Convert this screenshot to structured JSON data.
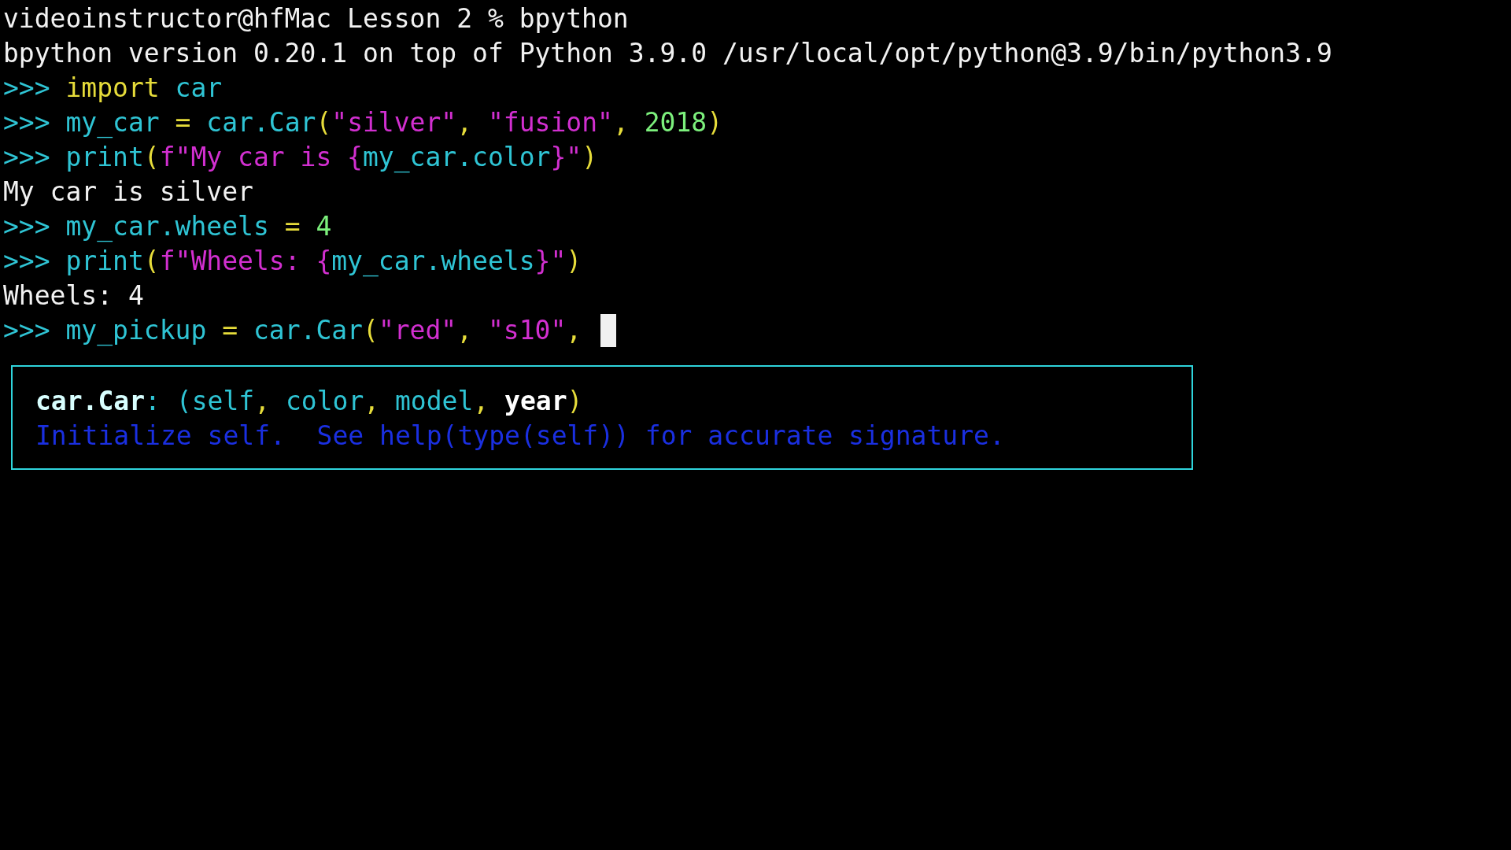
{
  "terminal": {
    "lines": [
      {
        "tokens": [
          {
            "text": "videoinstructor@hfMac Lesson 2 % bpython",
            "kind": "plain"
          }
        ]
      },
      {
        "tokens": [
          {
            "text": "bpython version 0.20.1 on top of Python 3.9.0 /usr/local/opt/python@3.9/bin/python3.9",
            "kind": "plain"
          }
        ]
      },
      {
        "tokens": [
          {
            "text": ">>> ",
            "kind": "prompt"
          },
          {
            "text": "import",
            "kind": "keyword"
          },
          {
            "text": " car",
            "kind": "name"
          }
        ]
      },
      {
        "tokens": [
          {
            "text": ">>> ",
            "kind": "prompt"
          },
          {
            "text": "my_car ",
            "kind": "name"
          },
          {
            "text": "=",
            "kind": "operator"
          },
          {
            "text": " car.Car",
            "kind": "name"
          },
          {
            "text": "(",
            "kind": "operator"
          },
          {
            "text": "\"silver\"",
            "kind": "string"
          },
          {
            "text": ", ",
            "kind": "operator"
          },
          {
            "text": "\"fusion\"",
            "kind": "string"
          },
          {
            "text": ", ",
            "kind": "operator"
          },
          {
            "text": "2018",
            "kind": "number"
          },
          {
            "text": ")",
            "kind": "operator"
          }
        ]
      },
      {
        "tokens": [
          {
            "text": ">>> ",
            "kind": "prompt"
          },
          {
            "text": "print",
            "kind": "name"
          },
          {
            "text": "(",
            "kind": "operator"
          },
          {
            "text": "f\"My car is {",
            "kind": "string"
          },
          {
            "text": "my_car.color",
            "kind": "name"
          },
          {
            "text": "}\"",
            "kind": "string"
          },
          {
            "text": ")",
            "kind": "operator"
          }
        ]
      },
      {
        "tokens": [
          {
            "text": "My car is silver",
            "kind": "plain"
          }
        ]
      },
      {
        "tokens": [
          {
            "text": ">>> ",
            "kind": "prompt"
          },
          {
            "text": "my_car.wheels ",
            "kind": "name"
          },
          {
            "text": "= ",
            "kind": "operator"
          },
          {
            "text": "4",
            "kind": "number"
          }
        ]
      },
      {
        "tokens": [
          {
            "text": ">>> ",
            "kind": "prompt"
          },
          {
            "text": "print",
            "kind": "name"
          },
          {
            "text": "(",
            "kind": "operator"
          },
          {
            "text": "f\"Wheels: {",
            "kind": "string"
          },
          {
            "text": "my_car.wheels",
            "kind": "name"
          },
          {
            "text": "}\"",
            "kind": "string"
          },
          {
            "text": ")",
            "kind": "operator"
          }
        ]
      },
      {
        "tokens": [
          {
            "text": "Wheels: 4",
            "kind": "plain"
          }
        ]
      },
      {
        "tokens": [
          {
            "text": ">>> ",
            "kind": "prompt"
          },
          {
            "text": "my_pickup ",
            "kind": "name"
          },
          {
            "text": "=",
            "kind": "operator"
          },
          {
            "text": " car.Car",
            "kind": "name"
          },
          {
            "text": "(",
            "kind": "operator"
          },
          {
            "text": "\"red\"",
            "kind": "string"
          },
          {
            "text": ", ",
            "kind": "operator"
          },
          {
            "text": "\"s10\"",
            "kind": "string"
          },
          {
            "text": ", ",
            "kind": "operator"
          }
        ]
      }
    ]
  },
  "signature_popup": {
    "signature": [
      {
        "text": "car.Car",
        "kind": "func"
      },
      {
        "text": ": (self",
        "kind": "name"
      },
      {
        "text": ", ",
        "kind": "operator"
      },
      {
        "text": "color",
        "kind": "name"
      },
      {
        "text": ", ",
        "kind": "operator"
      },
      {
        "text": "model",
        "kind": "name"
      },
      {
        "text": ", ",
        "kind": "operator"
      },
      {
        "text": "year",
        "kind": "current"
      },
      {
        "text": ")",
        "kind": "operator"
      }
    ],
    "docstring": "Initialize self.  See help(type(self)) for accurate signature."
  }
}
